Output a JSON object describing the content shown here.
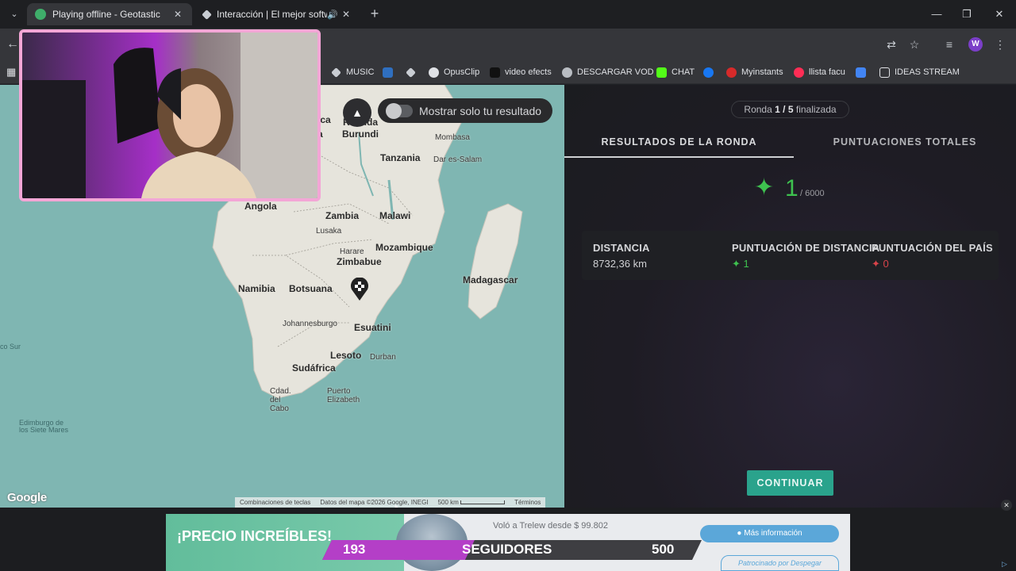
{
  "browser": {
    "tabs": [
      {
        "title": "Playing offline - Geotastic",
        "active": true
      },
      {
        "title": "Interacción | El mejor softw",
        "active": false
      }
    ],
    "bookmarks": [
      "MUSIC",
      "OpusClip",
      "video efects",
      "DESCARGAR VOD",
      "CHAT",
      "Myinstants",
      "llista facu",
      "IDEAS STREAM"
    ],
    "profile_initial": "W",
    "colors": {
      "frame": "#1e1f22",
      "toolbar": "#35363a"
    }
  },
  "map": {
    "toggle_label": "Mostrar solo tu resultado",
    "countries": [
      "Tanzania",
      "Angola",
      "Zambia",
      "Malawi",
      "Mozambique",
      "Zimbabue",
      "Namibia",
      "Botsuana",
      "Madagascar",
      "Esuatini",
      "Lesoto",
      "Sudáfrica",
      "Burundi",
      "Ruanda"
    ],
    "cities": [
      "Mombasa",
      "Dar es-Salam",
      "Lusaka",
      "Harare",
      "Johannesburgo",
      "Durban",
      "Cdad. del Cabo",
      "Puerto Elizabeth",
      "Edimburgo de los Siete Mares"
    ],
    "ocean_label": "co Sur",
    "partial_labels": [
      "ica",
      "a"
    ],
    "attribution": {
      "logo": "Google",
      "shortcuts": "Combinaciones de teclas",
      "data": "Datos del mapa ©2026 Google, INEGI",
      "scale": "500 km",
      "terms": "Términos"
    },
    "colors": {
      "water": "#7fb6b2",
      "land": "#e6e4dc"
    }
  },
  "results": {
    "round_prefix": "Ronda",
    "round_current": "1",
    "round_sep": "/",
    "round_total": "5",
    "round_suffix": "finalizada",
    "tabs": [
      "RESULTADOS DE LA RONDA",
      "PUNTUACIONES TOTALES"
    ],
    "score": "1",
    "score_max": "/ 6000",
    "stats": [
      {
        "label": "DISTANCIA",
        "value": "8732,36 km"
      },
      {
        "label": "PUNTUACIÓN DE DISTANCIA",
        "value": "1"
      },
      {
        "label": "PUNTUACIÓN DEL PAÍS",
        "value": "0"
      }
    ],
    "continue_label": "CONTINUAR",
    "colors": {
      "score_green": "#3ec14f",
      "country_red": "#d8434a",
      "continue_bg": "#2aa38c"
    }
  },
  "ad": {
    "headline": "¡PRECIO INCREÍBLES!",
    "offer": "Voló a Trelew desde $ 99.802",
    "info_button": "Más información",
    "sponsor": "Patrocinado por Despegar"
  },
  "followers": {
    "current": "193",
    "label": "SEGUIDORES",
    "goal": "500",
    "colors": {
      "fill": "#b43fc7",
      "track": "#3e3e42"
    }
  }
}
